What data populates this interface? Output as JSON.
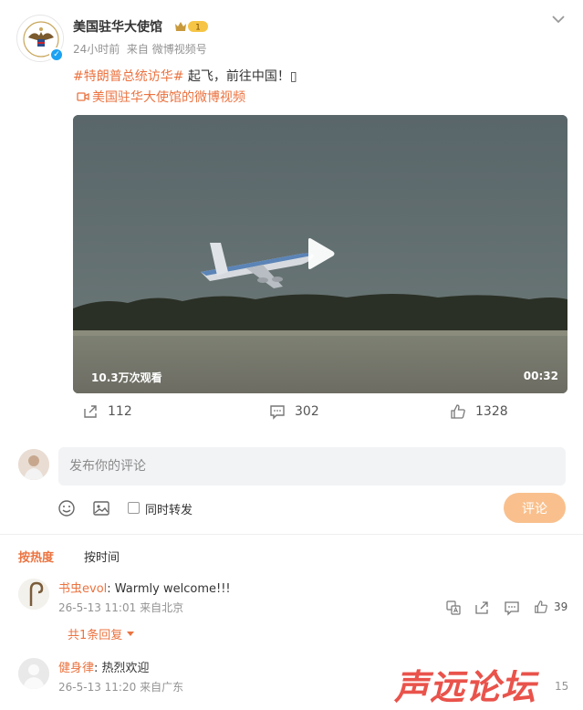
{
  "post": {
    "username": "美国驻华大使馆",
    "level": "1",
    "time": "24小时前",
    "source": "来自 微博视频号",
    "hashtag": "#特朗普总统访华#",
    "text": " 起飞，前往中国！",
    "text_tail": "▯",
    "video_link": "美国驻华大使馆的微博视频"
  },
  "video": {
    "views": "10.3万次观看",
    "duration": "00:32"
  },
  "actions": {
    "repost_count": "112",
    "comment_count": "302",
    "like_count": "1328"
  },
  "composer": {
    "placeholder": "发布你的评论",
    "repost_label": "同时转发",
    "submit_label": "评论"
  },
  "sort": {
    "hot": "按热度",
    "time": "按时间"
  },
  "comments": [
    {
      "name": "书虫evol",
      "text": ": Warmly welcome!!!",
      "time": "26-5-13 11:01",
      "location": "来自北京",
      "likes": "39",
      "replies": "共1条回复"
    },
    {
      "name": "健身律",
      "text": ": 热烈欢迎",
      "time": "26-5-13 11:20",
      "location": "来自广东",
      "likes": "15"
    }
  ],
  "watermark": "声远论坛",
  "colors": {
    "accent": "#eb7340",
    "verified": "#1da1f2",
    "submit": "#f9c08d"
  }
}
